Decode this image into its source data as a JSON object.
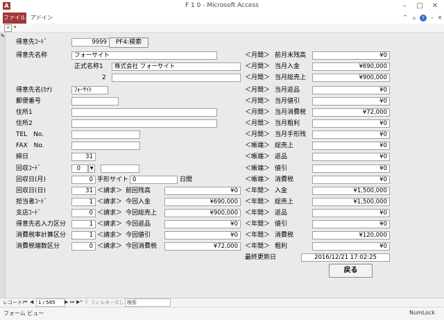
{
  "window": {
    "title": "F 1 0  -  Microsoft Access",
    "app_icon": "A"
  },
  "ribbon": {
    "tabs": [
      "ファイル",
      "アドイン"
    ]
  },
  "form": {
    "customer_code": {
      "label": "得意先ｺｰﾄﾞ",
      "value": "9999",
      "button": "PF4:検索"
    },
    "customer_name": {
      "label": "得意先名称",
      "value": "フォーサイト"
    },
    "official_name1": {
      "label": "正式名称1",
      "value": "株式会社 フォーサイト"
    },
    "official_name2": {
      "label": "2",
      "value": ""
    },
    "kana_name": {
      "label": "得意先名(ｶﾅ)",
      "value": "ﾌｫｰｻｲﾄ"
    },
    "postal_code": {
      "label": "郵便番号",
      "value": ""
    },
    "address1": {
      "label": "住所1",
      "value": ""
    },
    "address2": {
      "label": "住所2",
      "value": ""
    },
    "tel": {
      "label": "TEL　No.",
      "value": ""
    },
    "fax": {
      "label": "FAX　No.",
      "value": ""
    },
    "closing_day": {
      "label": "締日",
      "value": "31"
    },
    "collection_code": {
      "label": "回収ｺｰﾄﾞ",
      "value": "0",
      "extra": ""
    },
    "collection_month": {
      "label": "回収日(月)",
      "value": "0",
      "note_label": "手形サイト",
      "note_value": "0",
      "note_unit": "日間"
    },
    "collection_day": {
      "label": "回収日(日)",
      "value": "31"
    },
    "staff_code": {
      "label": "担当者ｺｰﾄﾞ",
      "value": "1"
    },
    "branch_code": {
      "label": "支店ｺｰﾄﾞ",
      "value": "0"
    },
    "customer_input_div": {
      "label": "得意先名入力区分",
      "value": "1"
    },
    "tax_calc_div": {
      "label": "消費税率計算区分",
      "value": "1"
    },
    "tax_round_div": {
      "label": "消費税端数区分",
      "value": "0"
    },
    "billing_tag": "＜請求＞",
    "billing": [
      {
        "label": "前回残高",
        "value": "¥0"
      },
      {
        "label": "今回入金",
        "value": "¥690,000"
      },
      {
        "label": "今回総売上",
        "value": "¥900,000"
      },
      {
        "label": "今回返品",
        "value": "¥0"
      },
      {
        "label": "今回値引",
        "value": "¥0"
      },
      {
        "label": "今回消費税",
        "value": "¥72,000"
      }
    ],
    "right": [
      {
        "tag": "＜月間＞",
        "label": "前月末残高",
        "value": "¥0"
      },
      {
        "tag": "＜月間＞",
        "label": "当月入金",
        "value": "¥690,000"
      },
      {
        "tag": "＜月間＞",
        "label": "当月総売上",
        "value": "¥900,000"
      },
      {
        "tag": "＜月間＞",
        "label": "当月返品",
        "value": "¥0"
      },
      {
        "tag": "＜月間＞",
        "label": "当月値引",
        "value": "¥0"
      },
      {
        "tag": "＜月間＞",
        "label": "当月消費税",
        "value": "¥72,000"
      },
      {
        "tag": "＜月間＞",
        "label": "当月粗利",
        "value": "¥0"
      },
      {
        "tag": "＜月間＞",
        "label": "当月手形残",
        "value": "¥0"
      },
      {
        "tag": "＜帳端＞",
        "label": "総売上",
        "value": "¥0"
      },
      {
        "tag": "＜帳端＞",
        "label": "返品",
        "value": "¥0"
      },
      {
        "tag": "＜帳端＞",
        "label": "値引",
        "value": "¥0"
      },
      {
        "tag": "＜帳端＞",
        "label": "消費税",
        "value": "¥0"
      },
      {
        "tag": "＜年間＞",
        "label": "入金",
        "value": "¥1,500,000"
      },
      {
        "tag": "＜年間＞",
        "label": "総売上",
        "value": "¥1,500,000"
      },
      {
        "tag": "＜年間＞",
        "label": "返品",
        "value": "¥0"
      },
      {
        "tag": "＜年間＞",
        "label": "値引",
        "value": "¥0"
      },
      {
        "tag": "＜年間＞",
        "label": "消費税",
        "value": "¥120,000"
      },
      {
        "tag": "＜年間＞",
        "label": "粗利",
        "value": "¥0"
      }
    ],
    "last_updated": {
      "label": "最終更新日",
      "value": "2016/12/21 17:02:25"
    },
    "back_button": "戻る"
  },
  "navbar": {
    "label": "レコード:",
    "record": "1 / 585",
    "filter": "フィルターなし",
    "search": "検索"
  },
  "status": {
    "left": "フォーム ビュー",
    "right": "NumLock"
  }
}
